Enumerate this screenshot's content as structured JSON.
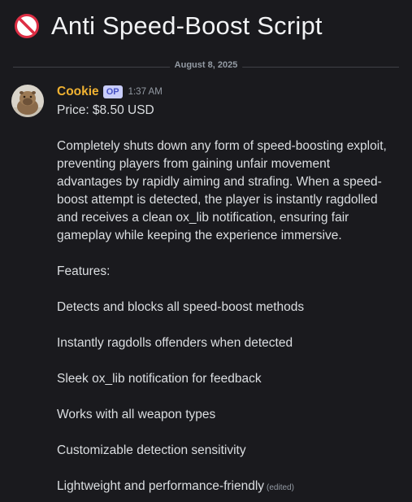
{
  "header": {
    "icon": "no-entry-icon",
    "title": "Anti Speed-Boost Script"
  },
  "divider": {
    "date": "August 8, 2025"
  },
  "message": {
    "author": "Cookie",
    "badge": "OP",
    "time": "1:37 AM",
    "price": "Price: $8.50 USD",
    "description": "Completely shuts down any form of speed-boosting exploit, preventing players from gaining unfair movement advantages by rapidly aiming and strafing. When a speed-boost attempt is detected, the player is instantly ragdolled and receives a clean ox_lib notification, ensuring fair gameplay while keeping the experience immersive.",
    "features_heading": "Features:",
    "features": [
      "Detects and blocks all speed-boost methods",
      "Instantly ragdolls offenders when detected",
      "Sleek ox_lib notification for feedback",
      "Works with all weapon types",
      "Customizable detection sensitivity",
      "Lightweight and performance-friendly"
    ],
    "edited": "(edited)"
  },
  "colors": {
    "background": "#1a1a1e",
    "author": "#f0b232",
    "text": "#dbdee1",
    "muted": "#949ba4",
    "no_icon": "#dd2e44"
  }
}
